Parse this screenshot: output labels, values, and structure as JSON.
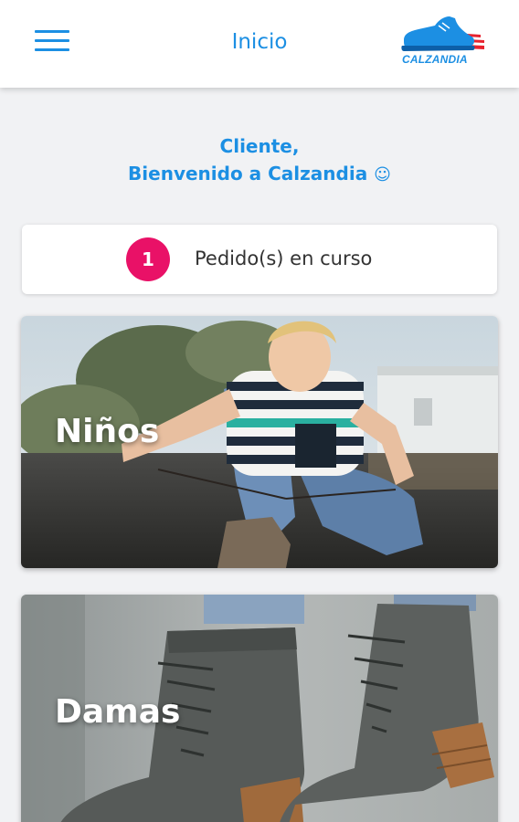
{
  "header": {
    "menu_icon": "hamburger-menu-icon",
    "title": "Inicio",
    "logo_text": "CALZANDIA"
  },
  "welcome": {
    "line1": "Cliente,",
    "line2": "Bienvenido a Calzandia",
    "emoji": "☺"
  },
  "orders": {
    "count": "1",
    "label": "Pedido(s) en curso"
  },
  "categories": [
    {
      "label": "Niños",
      "image": "child-tying-shoelace-photo"
    },
    {
      "label": "Damas",
      "image": "grey-lace-up-boots-photo"
    }
  ],
  "colors": {
    "accent": "#1c8fe3",
    "badge": "#e91167",
    "background": "#f1f2f4"
  }
}
